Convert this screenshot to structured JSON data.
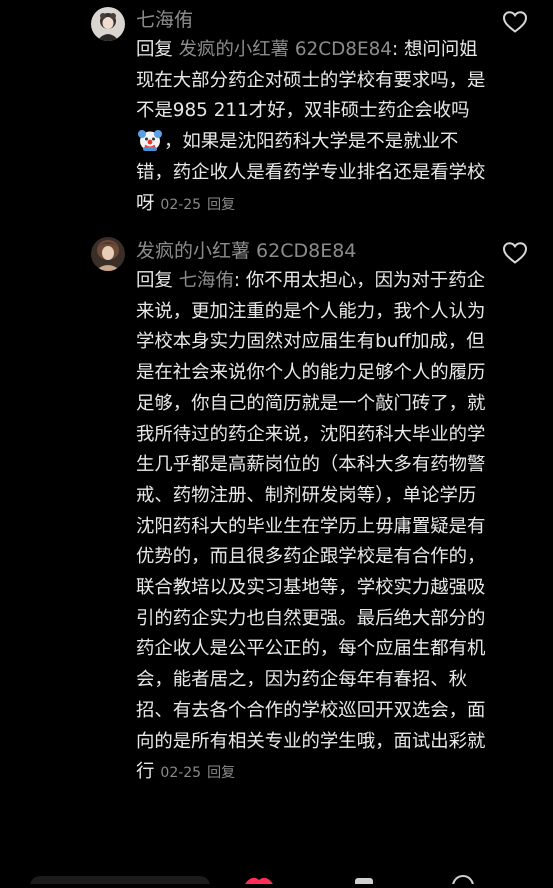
{
  "comments": [
    {
      "username": "七海侑",
      "reply_prefix": "回复",
      "reply_target": "发疯的小红薯 62CD8E84",
      "reply_colon": ": ",
      "text_part1": "想问问姐现在大部分药企对硕士的学校有要求吗，是不是985 211才好，双非硕士药企会收吗",
      "emoji": "clown-face-emoji",
      "text_part2": "，如果是沈阳药科大学是不是就业不错，药企收人是看药学专业排名还是看学校呀",
      "date": "02-25",
      "reply_label": "回复",
      "like_icon": "heart-outline-icon"
    },
    {
      "username": "发疯的小红薯 62CD8E84",
      "reply_prefix": "回复",
      "reply_target": "七海侑",
      "reply_colon": ": ",
      "text": "你不用太担心，因为对于药企来说，更加注重的是个人能力，我个人认为学校本身实力固然对应届生有buff加成，但是在社会来说你个人的能力足够个人的履历足够，你自己的简历就是一个敲门砖了，就我所待过的药企来说，沈阳药科大毕业的学生几乎都是高薪岗位的（本科大多有药物警戒、药物注册、制剂研发岗等），单论学历沈阳药科大的毕业生在学历上毋庸置疑是有优势的，而且很多药企跟学校是有合作的，联合教培以及实习基地等，学校实力越强吸引的药企实力也自然更强。最后绝大部分的药企收人是公平公正的，每个应届生都有机会，能者居之，因为药企每年有春招、秋招、有去各个合作的学校巡回开双选会，面向的是所有相关专业的学生哦，面试出彩就行",
      "date": "02-25",
      "reply_label": "回复",
      "like_icon": "heart-outline-icon"
    }
  ],
  "colors": {
    "background": "#000000",
    "text": "#e8e8e8",
    "muted": "#8c8c8c"
  }
}
